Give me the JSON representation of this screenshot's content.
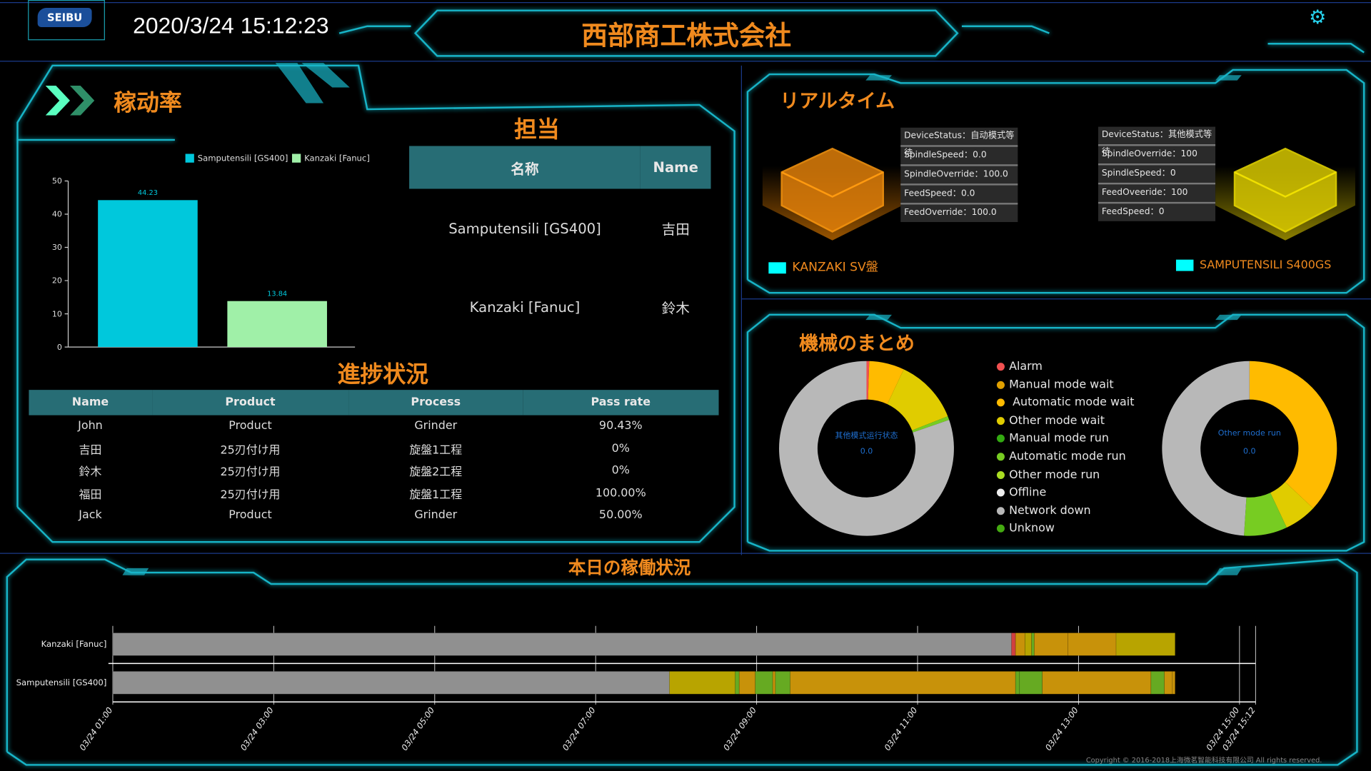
{
  "header": {
    "logo_text": "SEIBU",
    "datetime": "2020/3/24 15:12:23",
    "title": "西部商工株式会社",
    "settings_icon": "gear-icon"
  },
  "colors": {
    "accent": "#19b5c8",
    "title": "#f08a1e",
    "table_header": "#276d75"
  },
  "utilization": {
    "title": "稼动率",
    "chart_data": {
      "type": "bar",
      "categories": [
        "Samputensili [GS400]",
        "Kanzaki [Fanuc]"
      ],
      "values": [
        44.23,
        13.84
      ],
      "colors": [
        "#00c8dc",
        "#a0f0a8"
      ],
      "legend": [
        "Samputensili [GS400]",
        "Kanzaki [Fanuc]"
      ],
      "legend_position": "top-right",
      "ylim": [
        0,
        50
      ],
      "yticks": [
        "0",
        "10",
        "20",
        "30",
        "40",
        "50"
      ],
      "data_labels": [
        "44.23",
        "13.84"
      ],
      "grid": false
    }
  },
  "assignee": {
    "title": "担当",
    "headers": [
      "名称",
      "Name"
    ],
    "rows": [
      [
        "Samputensili [GS400]",
        "吉田"
      ],
      [
        "Kanzaki [Fanuc]",
        "鈴木"
      ]
    ]
  },
  "progress": {
    "title": "進捗状況",
    "headers": [
      "Name",
      "Product",
      "Process",
      "Pass rate"
    ],
    "rows": [
      [
        "John",
        "Product",
        "Grinder",
        "90.43%"
      ],
      [
        "吉田",
        "25刃付け用",
        "旋盤1工程",
        "0%"
      ],
      [
        "鈴木",
        "25刃付け用",
        "旋盤2工程",
        "0%"
      ],
      [
        "福田",
        "25刃付け用",
        "旋盤1工程",
        "100.00%"
      ],
      [
        "Jack",
        "Product",
        "Grinder",
        "50.00%"
      ]
    ]
  },
  "realtime": {
    "title": "リアルタイム",
    "machines": [
      {
        "label": "KANZAKI SV盤",
        "cube_color": "#ff9a10",
        "fields": [
          "DeviceStatus：自动模式等待",
          "SpindleSpeed：0.0",
          "SpindleOverride：100.0",
          "FeedSpeed：0.0",
          "FeedOverride：100.0"
        ]
      },
      {
        "label": "SAMPUTENSILI S400GS",
        "cube_color": "#f0e000",
        "fields": [
          "DeviceStatus：其他模式等待",
          "SpindleOverride：100",
          "SpindleSpeed：0",
          "FeedOveeride：100",
          "FeedSpeed：0"
        ]
      }
    ]
  },
  "summary": {
    "title": "機械のまとめ",
    "legend": [
      {
        "label": "Alarm",
        "color": "#f05050"
      },
      {
        "label": "Manual mode wait",
        "color": "#e0a000"
      },
      {
        "label": " Automatic mode wait",
        "color": "#ffbb00"
      },
      {
        "label": "Other mode wait",
        "color": "#e0cc00"
      },
      {
        "label": "Manual mode run",
        "color": "#33aa11"
      },
      {
        "label": "Automatic mode run",
        "color": "#77cc22"
      },
      {
        "label": "Other mode run",
        "color": "#aadd22"
      },
      {
        "label": "Offline",
        "color": "#eeeeee"
      },
      {
        "label": "Network down",
        "color": "#b8b8b8"
      },
      {
        "label": "Unknow",
        "color": "#44aa11"
      }
    ],
    "chart_data": [
      {
        "type": "pie",
        "donut": true,
        "center_label": "其他模式运行状态",
        "center_value": "0.0",
        "slices": [
          {
            "state": "Alarm",
            "value": 0.5
          },
          {
            "state": "Automatic mode wait",
            "value": 6.5
          },
          {
            "state": "Other mode wait",
            "value": 12
          },
          {
            "state": "Automatic mode run",
            "value": 0.7
          },
          {
            "state": "Network down",
            "value": 80.3
          }
        ]
      },
      {
        "type": "pie",
        "donut": true,
        "center_label": "Other mode run",
        "center_value": "0.0",
        "slices": [
          {
            "state": "Automatic mode wait",
            "value": 37
          },
          {
            "state": "Other mode wait",
            "value": 6
          },
          {
            "state": "Automatic mode run",
            "value": 8
          },
          {
            "state": "Network down",
            "value": 49
          }
        ]
      }
    ]
  },
  "timeline": {
    "title": "本日の稼働状況",
    "chart_data": {
      "type": "bar",
      "orientation": "horizontal-timeline",
      "xticks": [
        "03/24 01:00",
        "03/24 03:00",
        "03/24 05:00",
        "03/24 07:00",
        "03/24 09:00",
        "03/24 11:00",
        "03/24 13:00",
        "03/24 15:00",
        "03/24 15:12"
      ],
      "xlim": [
        "01:00",
        "15:12"
      ],
      "state_colors": {
        "offline": "#909090",
        "alarm": "#d04040",
        "wait": "#c8920a",
        "other_wait": "#b8a400",
        "run": "#66aa22"
      },
      "rows": [
        {
          "name": "Kanzaki [Fanuc]",
          "segments": [
            [
              "01:00",
              "12:10",
              "offline"
            ],
            [
              "12:10",
              "12:13",
              "alarm"
            ],
            [
              "12:13",
              "12:20",
              "wait"
            ],
            [
              "12:20",
              "12:25",
              "other_wait"
            ],
            [
              "12:25",
              "12:27",
              "run"
            ],
            [
              "12:27",
              "12:52",
              "wait"
            ],
            [
              "12:52",
              "13:28",
              "wait"
            ],
            [
              "13:28",
              "14:12",
              "other_wait"
            ]
          ]
        },
        {
          "name": "Samputensili [GS400]",
          "segments": [
            [
              "01:00",
              "07:55",
              "offline"
            ],
            [
              "07:55",
              "08:44",
              "other_wait"
            ],
            [
              "08:44",
              "08:47",
              "run"
            ],
            [
              "08:47",
              "08:59",
              "wait"
            ],
            [
              "08:59",
              "09:12",
              "run"
            ],
            [
              "09:12",
              "09:14",
              "wait"
            ],
            [
              "09:14",
              "09:25",
              "run"
            ],
            [
              "09:25",
              "12:13",
              "wait"
            ],
            [
              "12:13",
              "12:16",
              "run"
            ],
            [
              "12:16",
              "12:33",
              "run"
            ],
            [
              "12:33",
              "13:54",
              "wait"
            ],
            [
              "13:54",
              "14:04",
              "run"
            ],
            [
              "14:04",
              "14:10",
              "wait"
            ],
            [
              "14:10",
              "14:12",
              "wait"
            ]
          ]
        }
      ]
    }
  },
  "footer": {
    "copyright": "Copyright © 2016-2018上海微茗智能科技有限公司 All rights reserved."
  }
}
